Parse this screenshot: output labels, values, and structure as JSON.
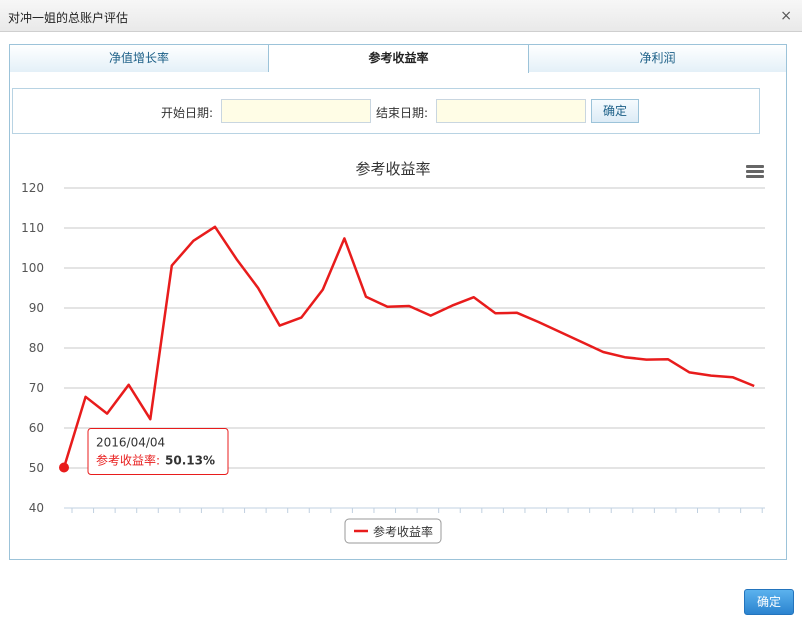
{
  "dialog": {
    "title": "对冲一姐的总账户评估",
    "close_label": "×"
  },
  "tabs": [
    {
      "label": "净值增长率",
      "active": false
    },
    {
      "label": "参考收益率",
      "active": true
    },
    {
      "label": "净利润",
      "active": false
    }
  ],
  "filter": {
    "start_label": "开始日期:",
    "start_value": "",
    "end_label": "结束日期:",
    "end_value": "",
    "confirm_label": "确定"
  },
  "footer": {
    "ok_label": "确定"
  },
  "chart_data": {
    "type": "line",
    "title": "参考收益率",
    "xlabel": "",
    "ylabel": "",
    "ylim": [
      40,
      120
    ],
    "yticks": [
      40,
      50,
      60,
      70,
      80,
      90,
      100,
      110,
      120
    ],
    "grid": true,
    "legend_position": "bottom-center",
    "series": [
      {
        "name": "参考收益率",
        "color": "#e81c1c",
        "values": [
          50.13,
          67.8,
          63.6,
          70.8,
          62.2,
          100.6,
          106.8,
          110.3,
          102.2,
          95.0,
          85.6,
          87.6,
          94.6,
          107.4,
          92.8,
          90.3,
          90.5,
          88.1,
          90.6,
          92.7,
          88.7,
          88.8,
          86.5,
          84.0,
          81.5,
          79.0,
          77.7,
          77.1,
          77.2,
          73.9,
          73.1,
          72.7,
          70.5
        ]
      }
    ],
    "tooltip": {
      "index": 0,
      "date": "2016/04/04",
      "series_label": "参考收益率:",
      "value_label": "50.13%"
    }
  }
}
